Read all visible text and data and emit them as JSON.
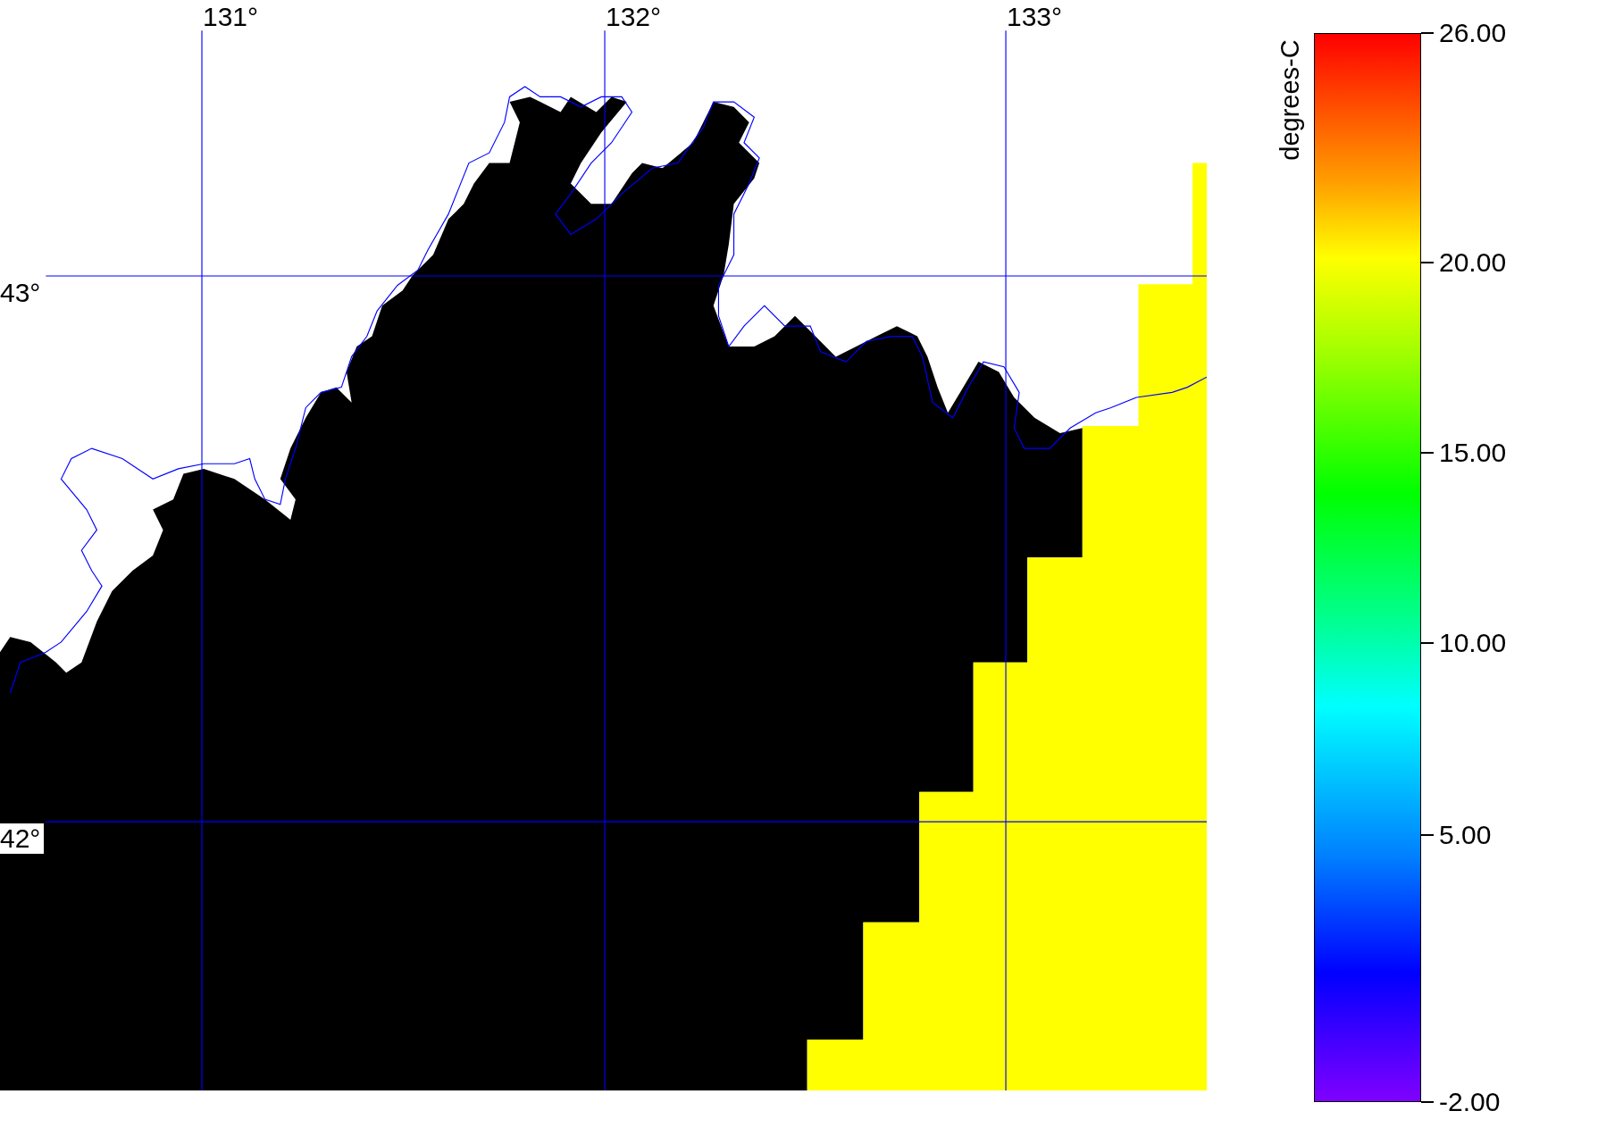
{
  "map": {
    "longitude_labels": [
      "131°",
      "132°",
      "133°"
    ],
    "latitude_labels": [
      "43°",
      "42°"
    ]
  },
  "colorbar": {
    "label": "degrees-C",
    "ticks": [
      "26.00",
      "20.00",
      "15.00",
      "10.00",
      "5.00",
      "-2.00"
    ]
  }
}
